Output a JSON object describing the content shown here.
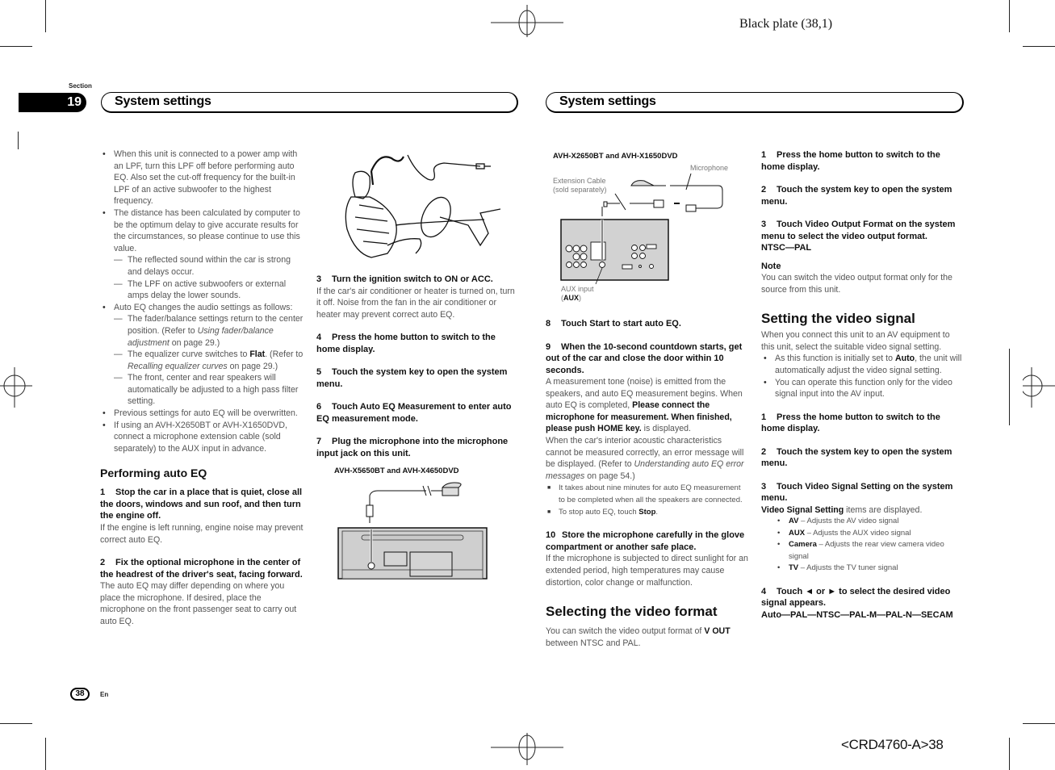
{
  "print_marks": {
    "plate": "Black plate (38,1)",
    "code": "<CRD4760-A>38"
  },
  "section": {
    "label": "Section",
    "number": "19"
  },
  "headers": {
    "left": "System settings",
    "right": "System settings"
  },
  "footer": {
    "page": "38",
    "lang": "En"
  },
  "col1": {
    "bullets": [
      "When this unit is connected to a power amp with an LPF, turn this LPF off before performing auto EQ. Also set the cut-off frequency for the built-in LPF of an active subwoofer to the highest frequency.",
      "The distance has been calculated by computer to be the optimum delay to give accurate results for the circumstances, so please continue to use this value."
    ],
    "distance_dashes": [
      "The reflected sound within the car is strong and delays occur.",
      "The LPF on active subwoofers or external amps delay the lower sounds."
    ],
    "auto_eq_bullet": "Auto EQ changes the audio settings as follows:",
    "auto_eq_dashes": {
      "d1_pre": "The fader/balance settings return to the center position. (Refer to ",
      "d1_ref": "Using fader/balance adjustment",
      "d1_post": " on page 29.)",
      "d2_pre": "The equalizer curve switches to ",
      "d2_bold": "Flat",
      "d2_mid": ". (Refer to ",
      "d2_ref": "Recalling equalizer curves",
      "d2_post": " on page 29.)",
      "d3": "The front, center and rear speakers will automatically be adjusted to a high pass filter setting."
    },
    "bullets_after": [
      "Previous settings for auto EQ will be overwritten.",
      "If using an AVH-X2650BT or AVH-X1650DVD, connect a microphone extension cable (sold separately) to the AUX input in advance."
    ],
    "heading": "Performing auto EQ",
    "steps": [
      {
        "num": "1",
        "title": "Stop the car in a place that is quiet, close all the doors, windows and sun roof, and then turn the engine off.",
        "body": "If the engine is left running, engine noise may prevent correct auto EQ."
      },
      {
        "num": "2",
        "title": "Fix the optional microphone in the center of the headrest of the driver's seat, facing forward.",
        "body": "The auto EQ may differ depending on where you place the microphone. If desired, place the microphone on the front passenger seat to carry out auto EQ."
      }
    ]
  },
  "col2": {
    "figure1": "car-seat-microphone-illustration",
    "steps": [
      {
        "num": "3",
        "title": "Turn the ignition switch to ON or ACC.",
        "body": "If the car's air conditioner or heater is turned on, turn it off. Noise from the fan in the air conditioner or heater may prevent correct auto EQ."
      },
      {
        "num": "4",
        "title": "Press the home button to switch to the home display.",
        "body": ""
      },
      {
        "num": "5",
        "title": "Touch the system key to open the system menu.",
        "body": ""
      },
      {
        "num": "6",
        "title": "Touch Auto EQ Measurement to enter auto EQ measurement mode.",
        "body": ""
      },
      {
        "num": "7",
        "title": "Plug the microphone into the microphone input jack on this unit.",
        "body": ""
      }
    ],
    "figure2_caption": "AVH-X5650BT and AVH-X4650DVD"
  },
  "col3": {
    "figure_caption": "AVH-X2650BT and AVH-X1650DVD",
    "figure_labels": {
      "microphone": "Microphone",
      "ext_cable_1": "Extension Cable",
      "ext_cable_2": "(sold separately)",
      "aux_1": "AUX input",
      "aux_2": "AUX"
    },
    "step8": {
      "num": "8",
      "title": "Touch Start to start auto EQ."
    },
    "step9": {
      "num": "9",
      "title": "When the 10-second countdown starts, get out of the car and close the door within 10 seconds.",
      "body1": "A measurement tone (noise) is emitted from the speakers, and auto EQ measurement begins. When auto EQ is completed, ",
      "body1_bold": "Please connect the microphone for measurement. When finished, please push HOME key.",
      "body1_post": " is displayed.",
      "body2_pre": "When the car's interior acoustic characteristics cannot be measured correctly, an error message will be displayed. (Refer to ",
      "body2_ref": "Understanding auto EQ error messages",
      "body2_post": " on page 54.)",
      "notes": [
        "It takes about nine minutes for auto EQ measurement to be completed when all the speakers are connected."
      ],
      "stop_note_pre": "To stop auto EQ, touch ",
      "stop_note_bold": "Stop",
      "stop_note_post": "."
    },
    "step10": {
      "num": "10",
      "title": "Store the microphone carefully in the glove compartment or another safe place.",
      "body": "If the microphone is subjected to direct sunlight for an extended period, high temperatures may cause distortion, color change or malfunction."
    },
    "video_format": {
      "heading": "Selecting the video format",
      "body_pre": "You can switch the video output format of ",
      "body_bold": "V OUT",
      "body_post": " between NTSC and PAL."
    }
  },
  "col4": {
    "steps_format": [
      {
        "num": "1",
        "title": "Press the home button to switch to the home display."
      },
      {
        "num": "2",
        "title": "Touch the system key to open the system menu."
      },
      {
        "num": "3",
        "title": "Touch Video Output Format on the system menu to select the video output format."
      }
    ],
    "format_options": "NTSC—PAL",
    "note_heading": "Note",
    "note_body": "You can switch the video output format only for the source from this unit.",
    "video_signal": {
      "heading": "Setting the video signal",
      "intro": "When you connect this unit to an AV equipment to this unit, select the suitable video signal setting.",
      "bullet1_pre": "As this function is initially set to ",
      "bullet1_bold": "Auto",
      "bullet1_post": ", the unit will automatically adjust the video signal setting.",
      "bullet2": "You can operate this function only for the video signal input into the AV input.",
      "step1": {
        "num": "1",
        "title": "Press the home button to switch to the home display."
      },
      "step2": {
        "num": "2",
        "title": "Touch the system key to open the system menu."
      },
      "step3": {
        "num": "3",
        "title": "Touch Video Signal Setting on the system menu."
      },
      "items_intro_bold": "Video Signal Setting",
      "items_intro_post": " items are displayed.",
      "items": [
        {
          "name": "AV",
          "desc": " – Adjusts the AV video signal"
        },
        {
          "name": "AUX",
          "desc": " – Adjusts the AUX video signal"
        },
        {
          "name": "Camera",
          "desc": " – Adjusts the rear view camera video signal"
        },
        {
          "name": "TV",
          "desc": " – Adjusts the TV tuner signal"
        }
      ],
      "step4": {
        "num": "4",
        "title": "Touch ◄ or ► to select the desired video signal appears."
      },
      "signal_options": "Auto—PAL—NTSC—PAL-M—PAL-N—SECAM"
    }
  }
}
